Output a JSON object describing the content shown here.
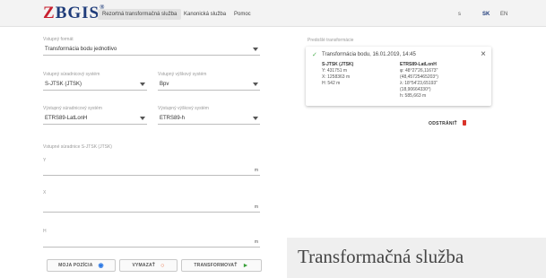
{
  "header": {
    "logo_main": "ZBGIS",
    "logo_sup": "®",
    "nav": [
      "Rezortná transformačná služba",
      "Kanonická služba",
      "Pomoc"
    ],
    "langs": [
      "s",
      "SK",
      "EN"
    ]
  },
  "form": {
    "type_label": "Vstupný formát",
    "type_value": "Transformácia bodu jednotlivo",
    "input_crs_label": "Vstupný súradnicový systém",
    "input_crs_value": "S-JTSK (JTSK)",
    "input_height_label": "Vstupný výškový systém",
    "input_height_value": "Bpv",
    "output_crs_label": "Výstupný súradnicový systém",
    "output_crs_value": "ETRS89-LatLonH",
    "output_height_label": "Výstupný výškový systém",
    "output_height_value": "ETRS89-h",
    "coords_label": "Vstupné súradnice S-JTSK (JTSK)",
    "fields": [
      {
        "label": "Y",
        "unit": "m"
      },
      {
        "label": "X",
        "unit": "m"
      },
      {
        "label": "H",
        "unit": "m"
      }
    ]
  },
  "buttons": {
    "position": "MOJA POZÍCIA",
    "clear": "VYMAZAŤ",
    "transform": "TRANSFORMOVAŤ"
  },
  "history": {
    "label": "Predošlé transformácie",
    "title": "Transformácia bodu, 16.01.2019, 14:45",
    "left_head": "S-JTSK (JTSK)",
    "left_rows": [
      "Y: 431751 m",
      "X: 1258363 m",
      "H: 542 m"
    ],
    "right_head": "ETRS89-LatLonH",
    "right_rows": [
      "φ: 48°27'26,11673\"",
      "(48,45725465203°)",
      "λ: 18°54'23,65193\"",
      "(18,90664330°)",
      "h: 585,663 m"
    ],
    "remove_label": "ODSTRÁNIŤ"
  },
  "caption": "Transformačná služba",
  "colors": {
    "brand_blue": "#1f3c7a",
    "brand_red": "#c8202f",
    "success_green": "#4caf50",
    "transform_green": "#3aa03a",
    "clear_orange": "#e65c2c",
    "position_blue": "#2b78e4",
    "remove_red": "#d9342b"
  },
  "icons": {
    "position": "crosshair-icon",
    "clear": "circle-refresh-icon",
    "transform": "arrow-play-icon",
    "history_status": "checkmark-icon",
    "close": "close-icon",
    "remove": "trash-icon"
  }
}
